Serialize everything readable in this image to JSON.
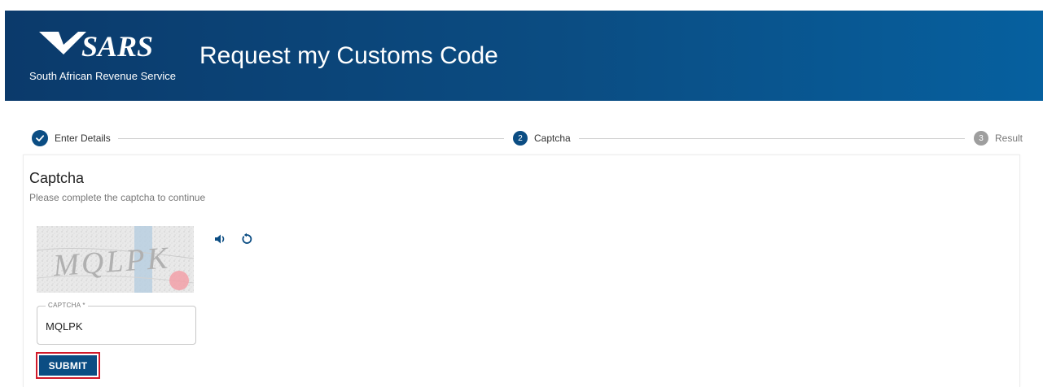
{
  "header": {
    "logo_text": "SARS",
    "logo_subtitle": "South African Revenue Service",
    "title": "Request my Customs Code",
    "background_color": "#0b4d83"
  },
  "stepper": {
    "steps": [
      {
        "number": "1",
        "label": "Enter Details",
        "state": "completed",
        "icon": "check-icon"
      },
      {
        "number": "2",
        "label": "Captcha",
        "state": "active"
      },
      {
        "number": "3",
        "label": "Result",
        "state": "pending"
      }
    ]
  },
  "card": {
    "title": "Captcha",
    "subtitle": "Please complete the captcha to continue"
  },
  "captcha": {
    "image_text": "MQLPK",
    "audio_icon": "speaker-icon",
    "refresh_icon": "refresh-icon",
    "field_label": "CAPTCHA *",
    "field_value": "MQLPK"
  },
  "actions": {
    "submit_label": "SUBMIT",
    "highlight_color": "#d11a2a"
  }
}
